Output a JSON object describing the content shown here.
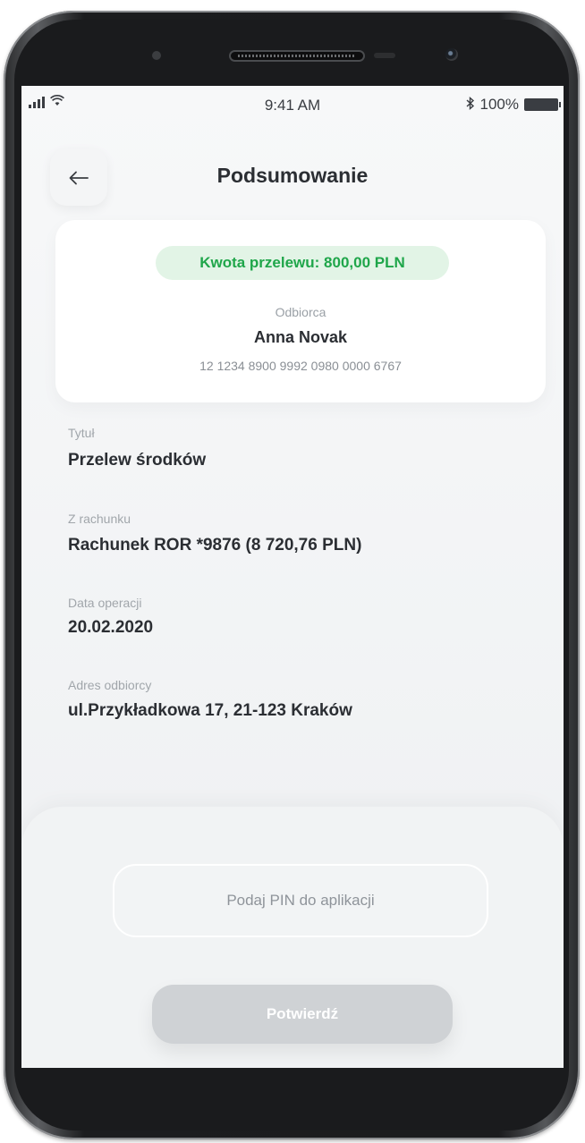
{
  "status_bar": {
    "time": "9:41 AM",
    "battery": "100%",
    "icons": [
      "signal-icon",
      "wifi-icon",
      "bluetooth-icon",
      "battery-icon"
    ]
  },
  "header": {
    "title": "Podsumowanie",
    "back_icon": "arrow-left-icon"
  },
  "summary": {
    "amount": "Kwota przelewu: 800,00 PLN",
    "recipient_label": "Odbiorca",
    "recipient_name": "Anna Novak",
    "recipient_account": "12 1234 8900 9992 0980 0000 6767"
  },
  "details": [
    {
      "label": "Tytuł",
      "value": "Przelew środków"
    },
    {
      "label": "Z rachunku",
      "value": "Rachunek ROR *9876 (8 720,76 PLN)"
    },
    {
      "label": "Data operacji",
      "value": "20.02.2020"
    },
    {
      "label": "Adres odbiorcy",
      "value": "ul.Przykładkowa 17, 21-123 Kraków"
    }
  ],
  "pin": {
    "placeholder": "Podaj PIN do aplikacji",
    "value": ""
  },
  "confirm_button": "Potwierdź",
  "colors": {
    "amount_text": "#1fa64a",
    "amount_background": "#e2f4e6",
    "button_disabled": "#cfd2d5"
  }
}
